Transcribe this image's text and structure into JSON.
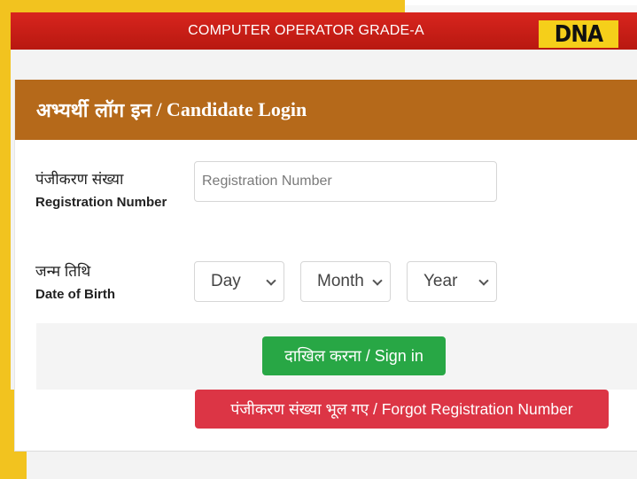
{
  "header": {
    "title": "COMPUTER OPERATOR GRADE-A",
    "logo_text": "DNA"
  },
  "login_card": {
    "title_hi": "अभ्यर्थी लॉग इन",
    "title_en": " / Candidate Login",
    "registration": {
      "label_hi": "पंजीकरण संख्या",
      "label_en": "Registration Number",
      "placeholder": "Registration Number",
      "value": ""
    },
    "dob": {
      "label_hi": "जन्म तिथि",
      "label_en": "Date of Birth",
      "day": "Day",
      "month": "Month",
      "year": "Year"
    },
    "signin_label": "दाखिल करना / Sign in",
    "forgot_label": "पंजीकरण संख्या भूल गए / Forgot Registration Number"
  },
  "colors": {
    "header_red": "#c81e16",
    "card_header_brown": "#b5691a",
    "signin_green": "#28a745",
    "forgot_red": "#dc3545",
    "frame_yellow": "#f2c31f",
    "logo_yellow": "#f5cf1a"
  }
}
